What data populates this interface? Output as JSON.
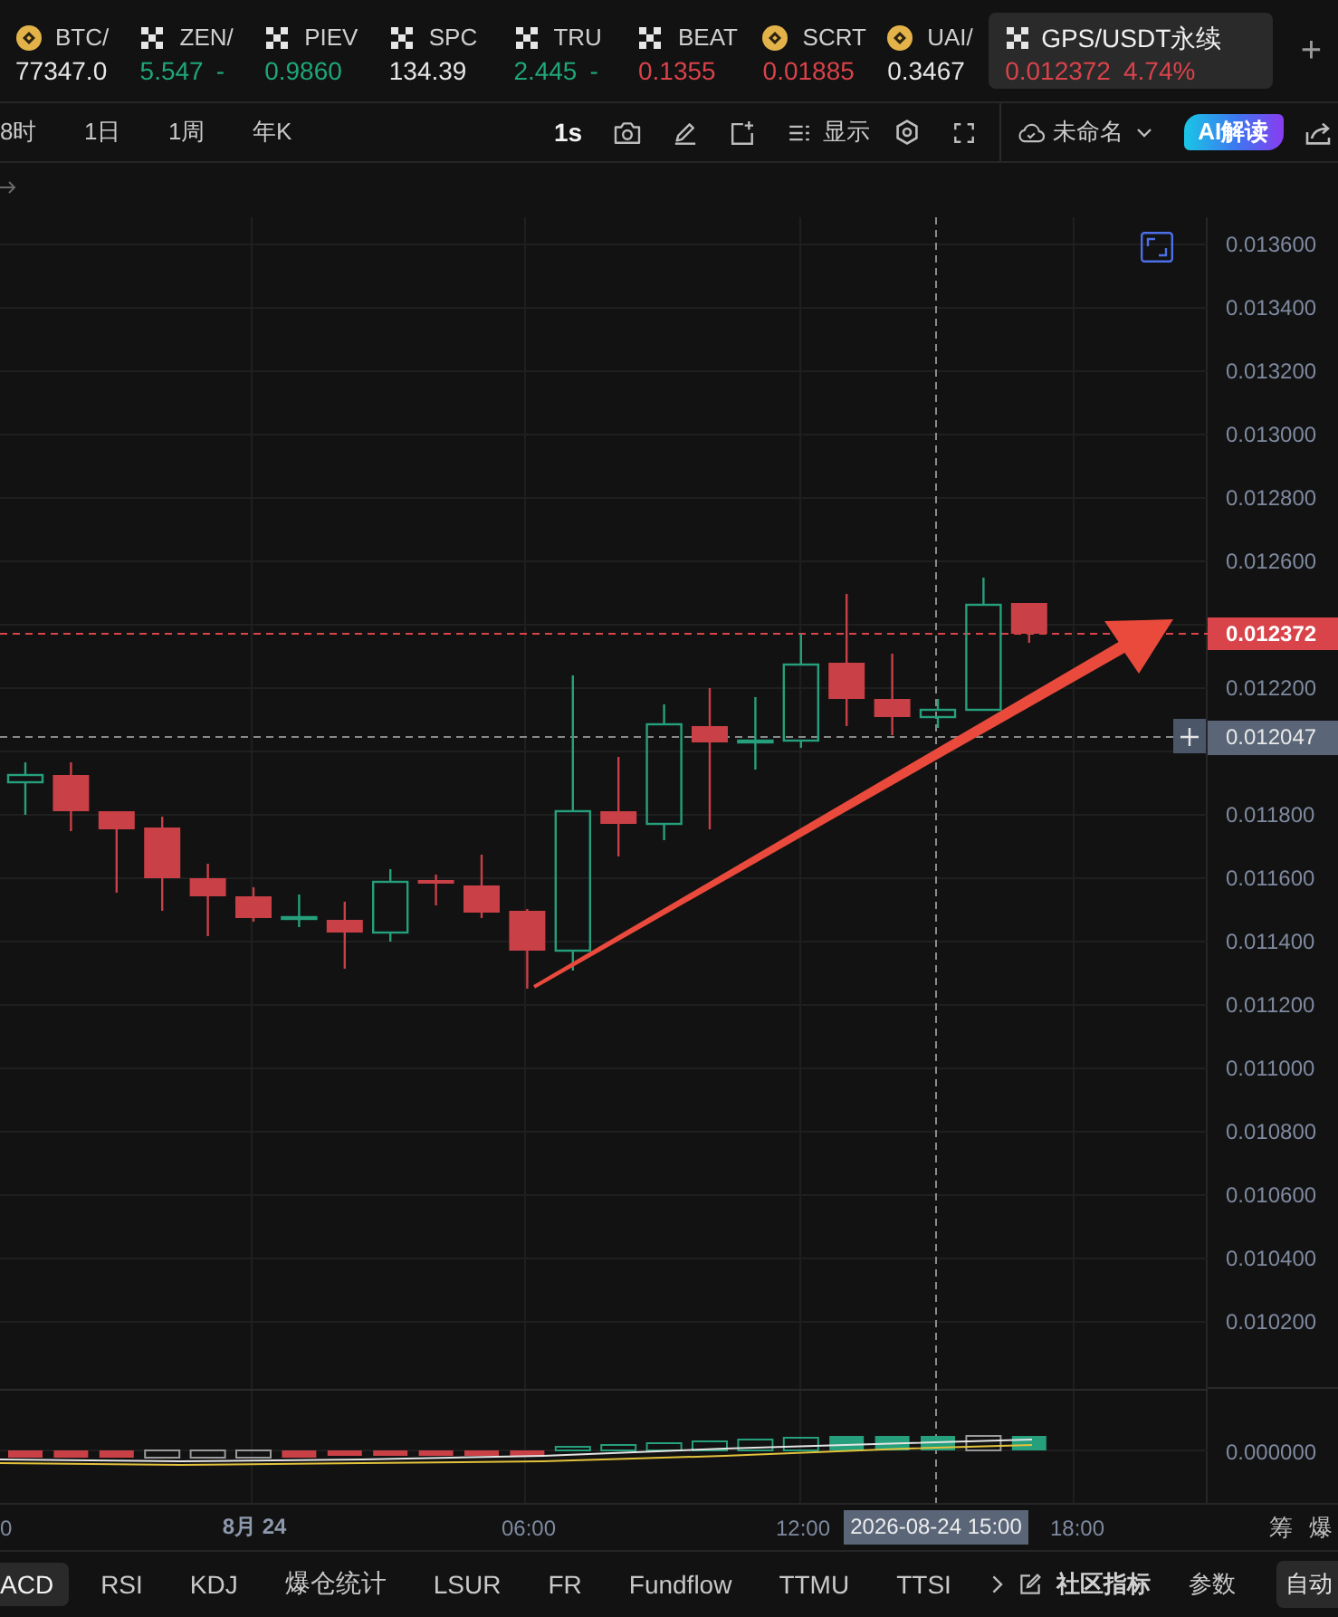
{
  "tickers": [
    {
      "kind": "coin",
      "symbol": "BTC/",
      "price": "77347.0",
      "color": "#e6e6e6",
      "selected": false
    },
    {
      "kind": "checker",
      "symbol": "ZEN/",
      "price": "5.547",
      "change": "-",
      "color": "#1fa67a",
      "selected": false
    },
    {
      "kind": "checker",
      "symbol": "PIEV",
      "price": "0.9860",
      "color": "#1fa67a",
      "selected": false
    },
    {
      "kind": "checker",
      "symbol": "SPC",
      "price": "134.39",
      "color": "#e6e6e6",
      "selected": false
    },
    {
      "kind": "checker",
      "symbol": "TRU",
      "price": "2.445",
      "change": "-",
      "color": "#1fa67a",
      "selected": false
    },
    {
      "kind": "checker",
      "symbol": "BEAT",
      "price": "0.1355",
      "color": "#d9434a",
      "selected": false
    },
    {
      "kind": "coin",
      "symbol": "SCRT",
      "price": "0.01885",
      "color": "#d9434a",
      "selected": false
    },
    {
      "kind": "coin",
      "symbol": "UAI/",
      "price": "0.3467",
      "color": "#e6e6e6",
      "selected": false
    },
    {
      "kind": "checker",
      "symbol": "GPS/USDT永续",
      "price": "0.012372",
      "change": "4.74%",
      "color": "#d9434a",
      "selected": true
    }
  ],
  "add_tab": "+",
  "toolbar": {
    "intervals": [
      "8时",
      "1日",
      "1周",
      "年K"
    ],
    "tick_interval": "1s",
    "display": "显示",
    "layout_name": "未命名",
    "ai_button": "AI解读"
  },
  "chart": {
    "price_ticks": [
      "0.013600",
      "0.013400",
      "0.013200",
      "0.013000",
      "0.012800",
      "0.012600",
      "0.012200",
      "0.011800",
      "0.011600",
      "0.011400",
      "0.011200",
      "0.011000",
      "0.010800",
      "0.010600",
      "0.010400",
      "0.010200"
    ],
    "current_price": "0.012372",
    "crosshair_price": "0.012047",
    "macd_tick": "0.000000",
    "time_ticks": [
      {
        "label": "0",
        "kind": "time"
      },
      {
        "label": "8月 24",
        "kind": "day"
      },
      {
        "label": "06:00",
        "kind": "time"
      },
      {
        "label": "12:00",
        "kind": "time"
      },
      {
        "label": "18:00",
        "kind": "time"
      }
    ],
    "crosshair_time": "2026-08-24 15:00",
    "side_buttons": [
      "筹",
      "爆"
    ]
  },
  "indicators": {
    "tabs": [
      {
        "label": "ACD",
        "selected": true
      },
      {
        "label": "RSI",
        "selected": false
      },
      {
        "label": "KDJ",
        "selected": false
      },
      {
        "label": "爆仓统计",
        "selected": false
      },
      {
        "label": "LSUR",
        "selected": false
      },
      {
        "label": "FR",
        "selected": false
      },
      {
        "label": "Fundflow",
        "selected": false
      },
      {
        "label": "TTMU",
        "selected": false
      },
      {
        "label": "TTSI",
        "selected": false
      }
    ],
    "community": "社区指标",
    "params": "参数",
    "auto": "自动"
  }
}
